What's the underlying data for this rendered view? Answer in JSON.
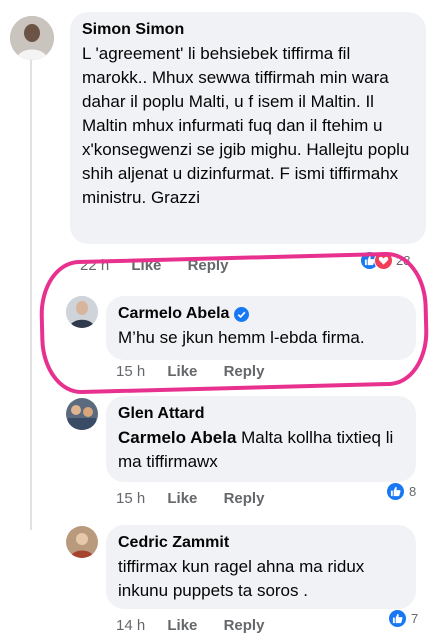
{
  "comments": [
    {
      "author": "Simon Simon",
      "text": "L 'agreement' li behsiebek tiffirma fil marokk.. Mhux sewwa tiffirmah min wara dahar il poplu Malti, u f isem il Maltin. Il Maltin mhux infurmati fuq dan il ftehim u x'konsegwenzi se jgib mighu. Hallejtu poplu shih aljenat u dizinfurmat. F ismi tiffirmahx ministru. Grazzi",
      "time": "22 h",
      "like_label": "Like",
      "reply_label": "Reply",
      "reaction_count": "28",
      "reactions": [
        "like-icon",
        "heart-icon"
      ]
    },
    {
      "author": "Carmelo Abela",
      "verified": true,
      "text": "M’hu se jkun hemm l-ebda firma.",
      "time": "15 h",
      "like_label": "Like",
      "reply_label": "Reply"
    },
    {
      "author": "Glen Attard",
      "mention": "Carmelo Abela",
      "text": " Malta kollha tixtieq li ma tiffirmawx",
      "time": "15 h",
      "like_label": "Like",
      "reply_label": "Reply",
      "reaction_count": "8"
    },
    {
      "author": "Cedric Zammit",
      "text": "tiffirmax kun ragel ahna ma ridux inkunu puppets ta soros .",
      "time": "14 h",
      "like_label": "Like",
      "reply_label": "Reply",
      "reaction_count": "7"
    }
  ],
  "colors": {
    "bubble": "#f0f2f5",
    "meta": "#65676b",
    "like_blue": "#1877f2",
    "highlight": "#e8318f"
  }
}
